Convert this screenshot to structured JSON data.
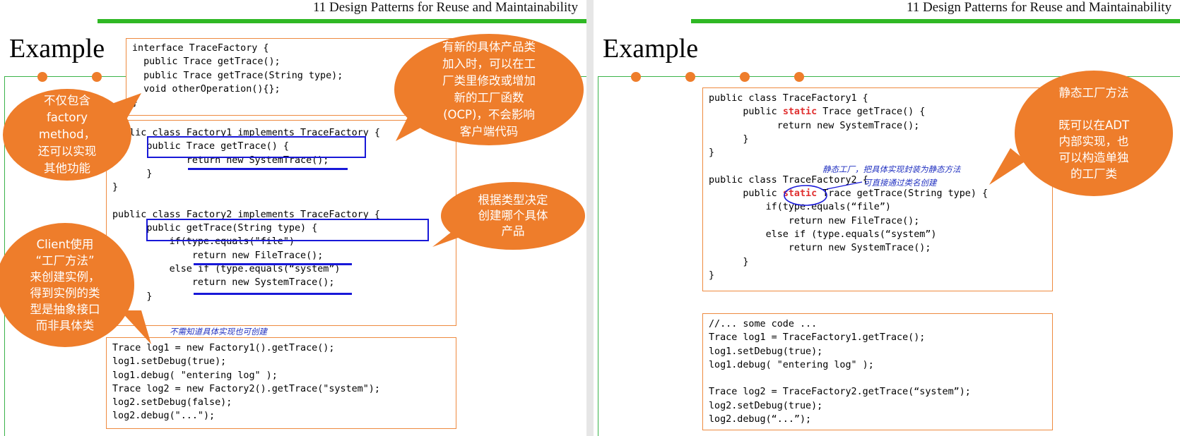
{
  "left_slide": {
    "header": "11 Design Patterns for Reuse and Maintainability",
    "title": "Example",
    "code_interface": [
      "interface TraceFactory {",
      "  public Trace getTrace();",
      "  public Trace getTrace(String type);",
      "  void otherOperation(){};",
      "}"
    ],
    "code_factories": [
      "public class Factory1 implements TraceFactory {",
      "      public Trace getTrace() {",
      "             return new SystemTrace();",
      "      }",
      "}",
      "",
      "public class Factory2 implements TraceFactory {",
      "      public getTrace(String type) {",
      "          if(type.equals(\"file\")",
      "              return new FileTrace();",
      "          else if (type.equals(“system”)",
      "              return new SystemTrace();",
      "      }"
    ],
    "code_client": [
      "Trace log1 = new Factory1().getTrace();",
      "log1.setDebug(true);",
      "log1.debug( \"entering log\" );",
      "Trace log2 = new Factory2().getTrace(\"system\");",
      "log2.setDebug(false);",
      "log2.debug(\"...\");"
    ],
    "bubble_top": "有新的具体产品类\n加入时，可以在工\n厂类里修改或增加\n新的工厂函数\n(OCP)，不会影响\n客户端代码",
    "bubble_left": "不仅包含\nfactory\nmethod，\n还可以实现\n其他功能",
    "bubble_right": "根据类型决定\n创建哪个具体\n产品",
    "bubble_client": "Client使用\n“工厂方法”\n来创建实例，\n得到实例的类\n型是抽象接口\n而非具体类",
    "handwritten_note": "不需知道具体实现也可创建"
  },
  "right_slide": {
    "header": "11 Design Patterns for Reuse and Maintainability",
    "title": "Example",
    "code_factory1": [
      "public class TraceFactory1 {",
      "      public ",
      "static",
      " Trace getTrace() {",
      "            return new SystemTrace();",
      "      }",
      "}"
    ],
    "code_factory2": [
      "public class TraceFactory2 {",
      "      public ",
      "static",
      " Trace getTrace(String type) {",
      "          if(type.equals(“file”)",
      "              return new FileTrace();",
      "          else if (type.equals(“system”)",
      "              return new SystemTrace();",
      "      }",
      "}"
    ],
    "code_client": [
      "//... some code ...",
      "Trace log1 = TraceFactory1.getTrace();",
      "log1.setDebug(true);",
      "log1.debug( \"entering log\" );",
      "",
      "Trace log2 = TraceFactory2.getTrace(“system”);",
      "log2.setDebug(true);",
      "log2.debug(“...”);"
    ],
    "bubble": "静态工厂方法\n\n既可以在ADT\n内部实现，也\n可以构造单独\n的工厂类",
    "handwritten_note_1": "静态工厂，把具体实现封装为静态方法",
    "handwritten_note_2": "可直接通过类名创建"
  },
  "colors": {
    "accent_orange": "#ee7d2b",
    "green": "#2fb824",
    "highlight_blue": "#1818d8",
    "keyword_red": "#e03030"
  }
}
